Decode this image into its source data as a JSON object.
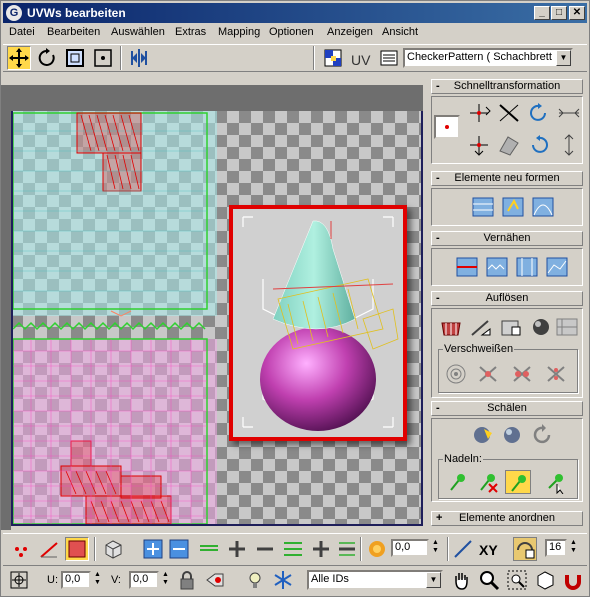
{
  "window": {
    "title": "UVWs bearbeiten",
    "app_icon": "G",
    "minimize": "_",
    "maximize": "□",
    "close": "✕"
  },
  "menu": [
    "Datei",
    "Bearbeiten",
    "Auswählen",
    "Extras",
    "Mapping",
    "Optionen",
    "Anzeigen",
    "Ansicht"
  ],
  "toolbar": {
    "uv_label": "UV",
    "texture_combo": "CheckerPattern  ( Schachbrett"
  },
  "panel": {
    "schnelltransformation": "Schnelltransformation",
    "elemente_neu_formen": "Elemente neu formen",
    "vernaehen": "Vernähen",
    "aufloesen": "Auflösen",
    "verschweissen": "Verschweißen",
    "schaelen": "Schälen",
    "nadeln": "Nadeln:",
    "elemente_anordnen": "Elemente anordnen",
    "collapse_sign": "-",
    "expand_sign": "+"
  },
  "bottom": {
    "spinner_value": "0,0",
    "xy_label": "XY",
    "grid_value": "16",
    "u_label": "U:",
    "u_value": "0,0",
    "v_label": "V:",
    "v_value": "0,0",
    "id_filter": "Alle IDs"
  },
  "colors": {
    "title_start": "#0a246a",
    "title_end": "#3a6ea5",
    "selection": "#e00000",
    "active_tool": "#ffd84a"
  }
}
